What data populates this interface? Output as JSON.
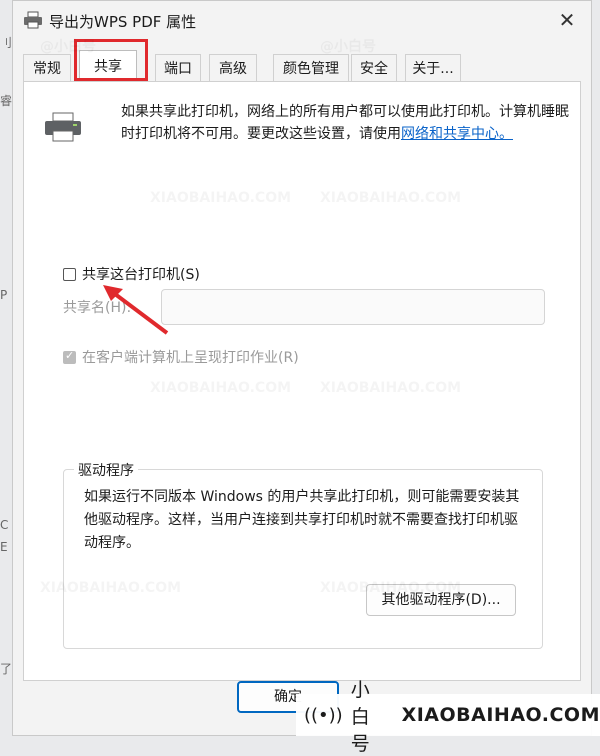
{
  "window": {
    "title": "导出为WPS PDF 属性",
    "close_glyph": "✕"
  },
  "tabs": [
    {
      "label": "常规",
      "active": false
    },
    {
      "label": "共享",
      "active": true
    },
    {
      "label": "端口",
      "active": false
    },
    {
      "label": "高级",
      "active": false
    },
    {
      "label": "颜色管理",
      "active": false
    },
    {
      "label": "安全",
      "active": false
    },
    {
      "label": "关于...",
      "active": false
    }
  ],
  "sharing": {
    "info_text": "如果共享此打印机，网络上的所有用户都可以使用此打印机。计算机睡眠时打印机将不可用。要更改这些设置，请使用",
    "info_link": "网络和共享中心。",
    "share_checkbox_label": "共享这台打印机(S)",
    "share_checked": false,
    "share_name_label": "共享名(H):",
    "share_name_value": "",
    "render_jobs_label": "在客户端计算机上呈现打印作业(R)",
    "render_jobs_checked": true
  },
  "drivers": {
    "group_title": "驱动程序",
    "text": "如果运行不同版本 Windows 的用户共享此打印机，则可能需要安装其他驱动程序。这样，当用户连接到共享打印机时就不需要查找打印机驱动程序。",
    "button_label": "其他驱动程序(D)..."
  },
  "footer": {
    "ok_label": "确定"
  },
  "left_edge": [
    "刂",
    "睿",
    "P",
    "C",
    "E",
    "了"
  ],
  "watermarks": {
    "brand": "@小白号",
    "domain": "XIAOBAIHAO.COM"
  },
  "branding": {
    "name": "小白号",
    "domain": "XIAOBAIHAO.COM",
    "icon": "signal-icon"
  },
  "colors": {
    "accent": "#0067c0",
    "highlight": "#e0292d",
    "link": "#0a63c9"
  }
}
